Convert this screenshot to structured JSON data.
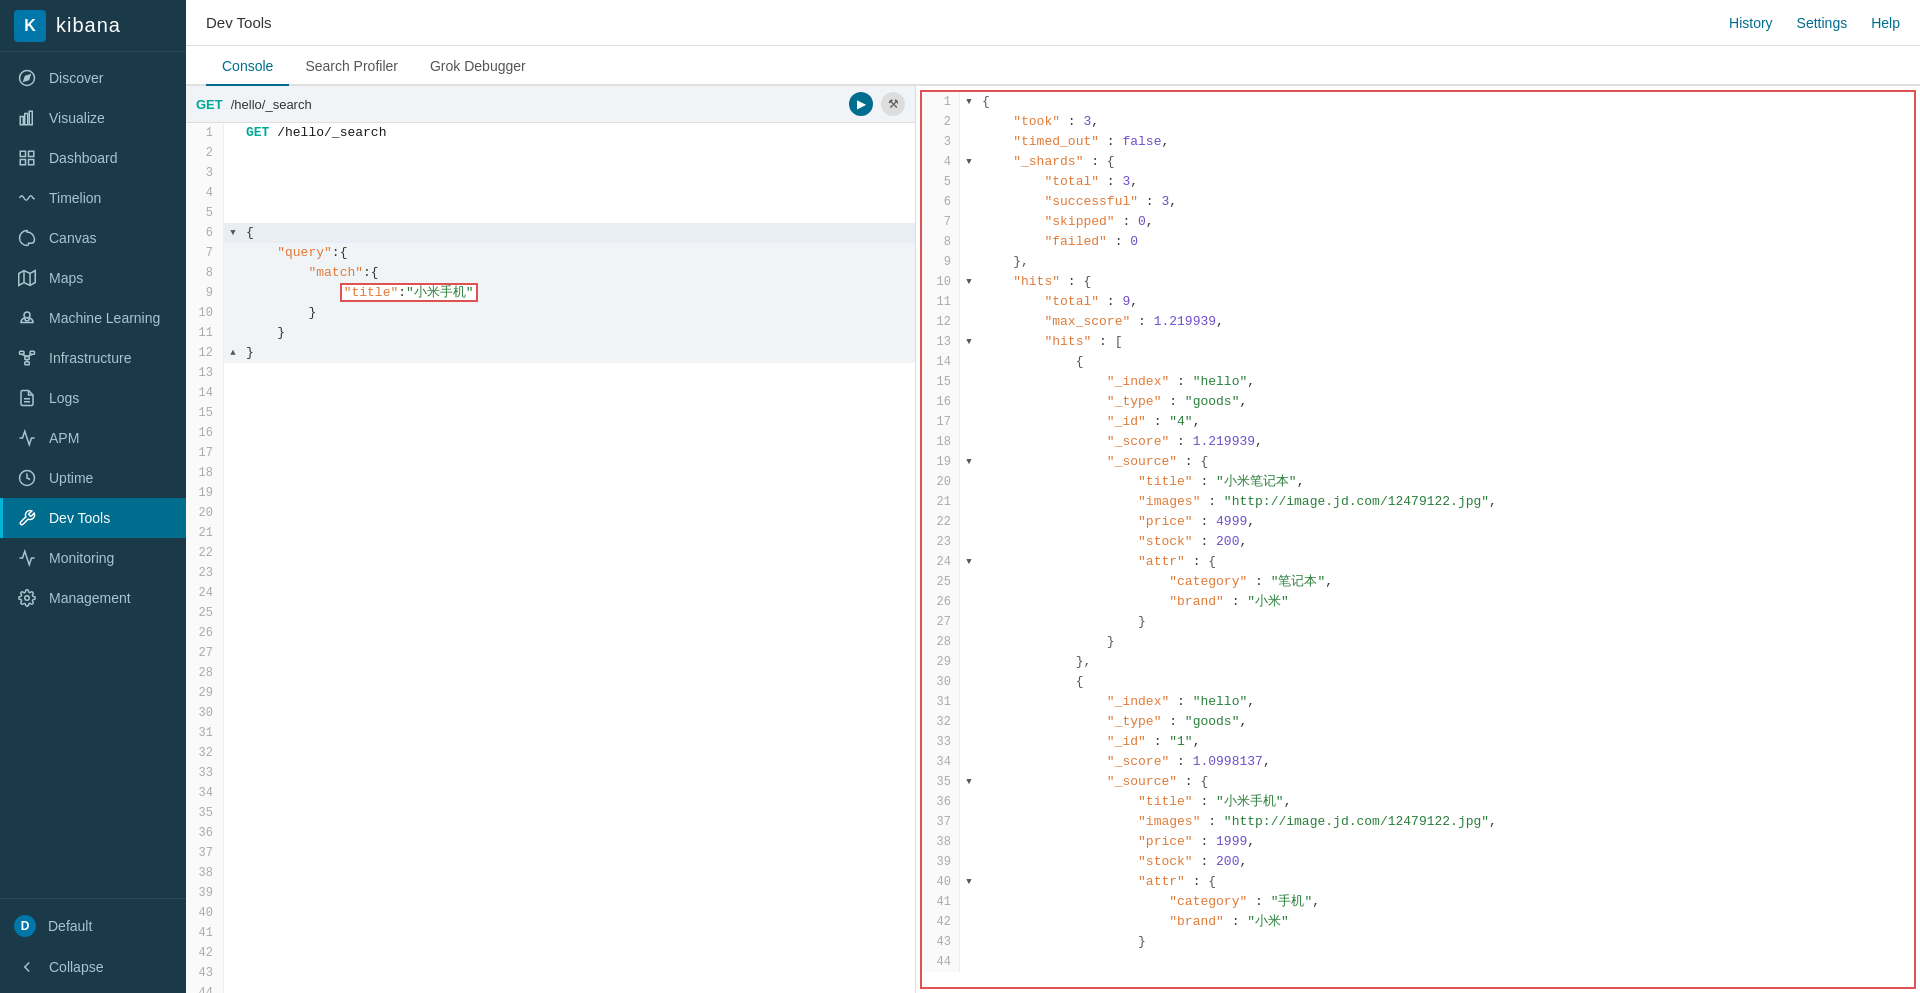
{
  "sidebar": {
    "logo_letter": "K",
    "logo_text": "kibana",
    "items": [
      {
        "id": "discover",
        "label": "Discover",
        "icon": "compass"
      },
      {
        "id": "visualize",
        "label": "Visualize",
        "icon": "bar-chart"
      },
      {
        "id": "dashboard",
        "label": "Dashboard",
        "icon": "grid"
      },
      {
        "id": "timelion",
        "label": "Timelion",
        "icon": "wave"
      },
      {
        "id": "canvas",
        "label": "Canvas",
        "icon": "palette"
      },
      {
        "id": "maps",
        "label": "Maps",
        "icon": "map"
      },
      {
        "id": "machine-learning",
        "label": "Machine Learning",
        "icon": "brain"
      },
      {
        "id": "infrastructure",
        "label": "Infrastructure",
        "icon": "network"
      },
      {
        "id": "logs",
        "label": "Logs",
        "icon": "document"
      },
      {
        "id": "apm",
        "label": "APM",
        "icon": "apm"
      },
      {
        "id": "uptime",
        "label": "Uptime",
        "icon": "clock"
      },
      {
        "id": "dev-tools",
        "label": "Dev Tools",
        "icon": "tools",
        "active": true
      },
      {
        "id": "monitoring",
        "label": "Monitoring",
        "icon": "monitoring"
      },
      {
        "id": "management",
        "label": "Management",
        "icon": "gear"
      }
    ],
    "default_label": "Default",
    "collapse_label": "Collapse"
  },
  "topbar": {
    "title": "Dev Tools",
    "history": "History",
    "settings": "Settings",
    "help": "Help"
  },
  "tabs": [
    {
      "id": "console",
      "label": "Console",
      "active": true
    },
    {
      "id": "search-profiler",
      "label": "Search Profiler"
    },
    {
      "id": "grok-debugger",
      "label": "Grok Debugger"
    }
  ],
  "editor": {
    "url_method": "GET",
    "url_path": "/hello/_search",
    "lines": [
      {
        "num": 1,
        "content": "GET /hello/_search",
        "type": "url"
      },
      {
        "num": 2,
        "content": ""
      },
      {
        "num": 3,
        "content": ""
      },
      {
        "num": 4,
        "content": ""
      },
      {
        "num": 5,
        "content": ""
      },
      {
        "num": 6,
        "content": "{",
        "arrow": "▼"
      },
      {
        "num": 7,
        "content": "    \"query\":{"
      },
      {
        "num": 8,
        "content": "        \"match\":{"
      },
      {
        "num": 9,
        "content": "            \"title\":\"小米手机\"",
        "highlight": true
      },
      {
        "num": 10,
        "content": "        }"
      },
      {
        "num": 11,
        "content": "    }"
      },
      {
        "num": 12,
        "content": "}",
        "arrow": "▲"
      }
    ]
  },
  "response": {
    "lines": [
      {
        "num": 1,
        "arrow": "▼",
        "content": "{"
      },
      {
        "num": 2,
        "content": "    \"took\" : 3,"
      },
      {
        "num": 3,
        "content": "    \"timed_out\" : false,"
      },
      {
        "num": 4,
        "arrow": "▼",
        "content": "    \"_shards\" : {"
      },
      {
        "num": 5,
        "content": "        \"total\" : 3,"
      },
      {
        "num": 6,
        "content": "        \"successful\" : 3,"
      },
      {
        "num": 7,
        "content": "        \"skipped\" : 0,"
      },
      {
        "num": 8,
        "content": "        \"failed\" : 0"
      },
      {
        "num": 9,
        "content": "    },"
      },
      {
        "num": 10,
        "arrow": "▼",
        "content": "    \"hits\" : {"
      },
      {
        "num": 11,
        "content": "        \"total\" : 9,"
      },
      {
        "num": 12,
        "content": "        \"max_score\" : 1.219939,"
      },
      {
        "num": 13,
        "arrow": "▼",
        "content": "        \"hits\" : ["
      },
      {
        "num": 14,
        "content": "            {"
      },
      {
        "num": 15,
        "content": "                \"_index\" : \"hello\","
      },
      {
        "num": 16,
        "content": "                \"_type\" : \"goods\","
      },
      {
        "num": 17,
        "content": "                \"_id\" : \"4\","
      },
      {
        "num": 18,
        "content": "                \"_score\" : 1.219939,"
      },
      {
        "num": 19,
        "arrow": "▼",
        "content": "                \"_source\" : {"
      },
      {
        "num": 20,
        "content": "                    \"title\" : \"小米笔记本\","
      },
      {
        "num": 21,
        "content": "                    \"images\" : \"http://image.jd.com/12479122.jpg\","
      },
      {
        "num": 22,
        "content": "                    \"price\" : 4999,"
      },
      {
        "num": 23,
        "content": "                    \"stock\" : 200,"
      },
      {
        "num": 24,
        "arrow": "▼",
        "content": "                    \"attr\" : {"
      },
      {
        "num": 25,
        "content": "                        \"category\" : \"笔记本\","
      },
      {
        "num": 26,
        "content": "                        \"brand\" : \"小米\""
      },
      {
        "num": 27,
        "content": "                    }"
      },
      {
        "num": 28,
        "content": "                }"
      },
      {
        "num": 29,
        "content": "            },"
      },
      {
        "num": 30,
        "content": "            {"
      },
      {
        "num": 31,
        "content": "                \"_index\" : \"hello\","
      },
      {
        "num": 32,
        "content": "                \"_type\" : \"goods\","
      },
      {
        "num": 33,
        "content": "                \"_id\" : \"1\","
      },
      {
        "num": 34,
        "content": "                \"_score\" : 1.0998137,"
      },
      {
        "num": 35,
        "arrow": "▼",
        "content": "                \"_source\" : {"
      },
      {
        "num": 36,
        "content": "                    \"title\" : \"小米手机\","
      },
      {
        "num": 37,
        "content": "                    \"images\" : \"http://image.jd.com/12479122.jpg\","
      },
      {
        "num": 38,
        "content": "                    \"price\" : 1999,"
      },
      {
        "num": 39,
        "content": "                    \"stock\" : 200,"
      },
      {
        "num": 40,
        "arrow": "▼",
        "content": "                    \"attr\" : {"
      },
      {
        "num": 41,
        "content": "                        \"category\" : \"手机\","
      },
      {
        "num": 42,
        "content": "                        \"brand\" : \"小米\""
      },
      {
        "num": 43,
        "content": "                    }"
      },
      {
        "num": 44,
        "content": ""
      }
    ]
  }
}
